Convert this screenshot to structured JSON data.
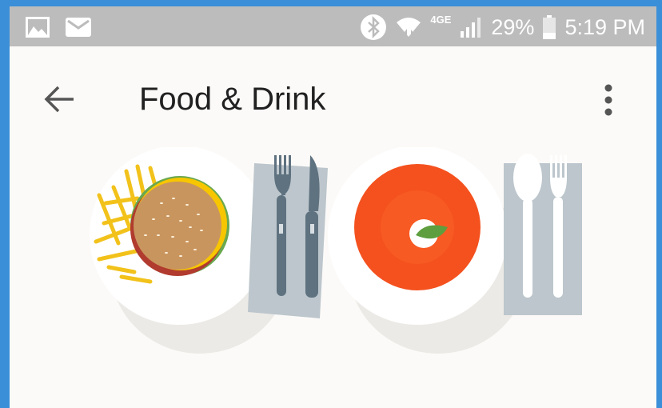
{
  "status_bar": {
    "left_icons": [
      "gallery-icon",
      "mail-icon"
    ],
    "right_icons": [
      "bluetooth-icon",
      "wifi-icon",
      "signal-icon",
      "battery-icon"
    ],
    "network": "4GE",
    "battery": "29%",
    "time": "5:19 PM"
  },
  "app_bar": {
    "back_icon": "arrow-back-icon",
    "title": "Food & Drink",
    "menu_icon": "more-vert-icon"
  },
  "illustration": {
    "items": [
      "burger-plate",
      "fork-knife-napkin",
      "soup-bowl",
      "spoon-fork-napkin"
    ],
    "colors": {
      "soup": "#f4511e",
      "napkin": "#bcc6cc",
      "cutlery": "#5f7280",
      "plate": "#ffffff"
    }
  }
}
